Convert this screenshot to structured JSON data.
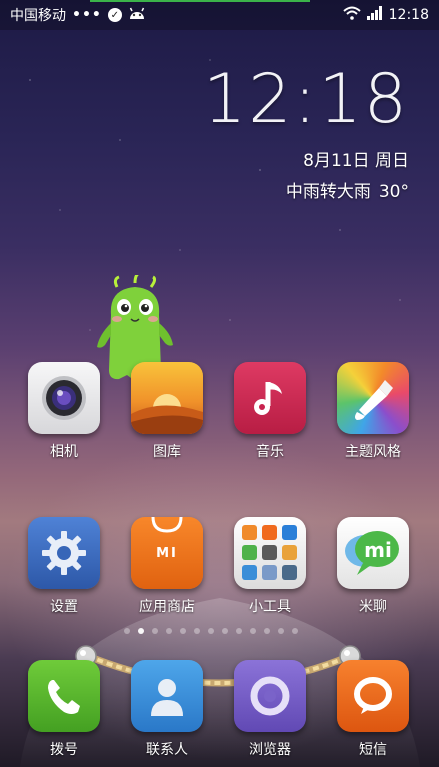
{
  "status_bar": {
    "carrier": "中国移动",
    "dots": "•••",
    "time": "12:18"
  },
  "clock_widget": {
    "time": "12:18",
    "date": "8月11日 周日",
    "weather": "中雨转大雨",
    "temperature": "30°"
  },
  "apps": {
    "camera": "相机",
    "gallery": "图库",
    "music": "音乐",
    "themes": "主题风格",
    "settings": "设置",
    "app_store": "应用商店",
    "tools": "小工具",
    "mitalk": "米聊"
  },
  "dock": {
    "phone": "拨号",
    "contacts": "联系人",
    "browser": "浏览器",
    "messages": "短信"
  },
  "page_indicator": {
    "total": 13,
    "active": 2
  },
  "icons": {
    "app_store_glyph": "MI",
    "mitalk_glyph": "mi"
  },
  "colors": {
    "camera": "#e9e9ea",
    "gallery": "#f3a02a",
    "music": "#c8234f",
    "settings": "#3c6ec6",
    "app_store": "#f07a1a",
    "mitalk": "#f2f2f2",
    "phone": "#5cb630",
    "contacts": "#3a8fd8",
    "browser": "#7a63c9",
    "messages": "#f06a1e"
  }
}
